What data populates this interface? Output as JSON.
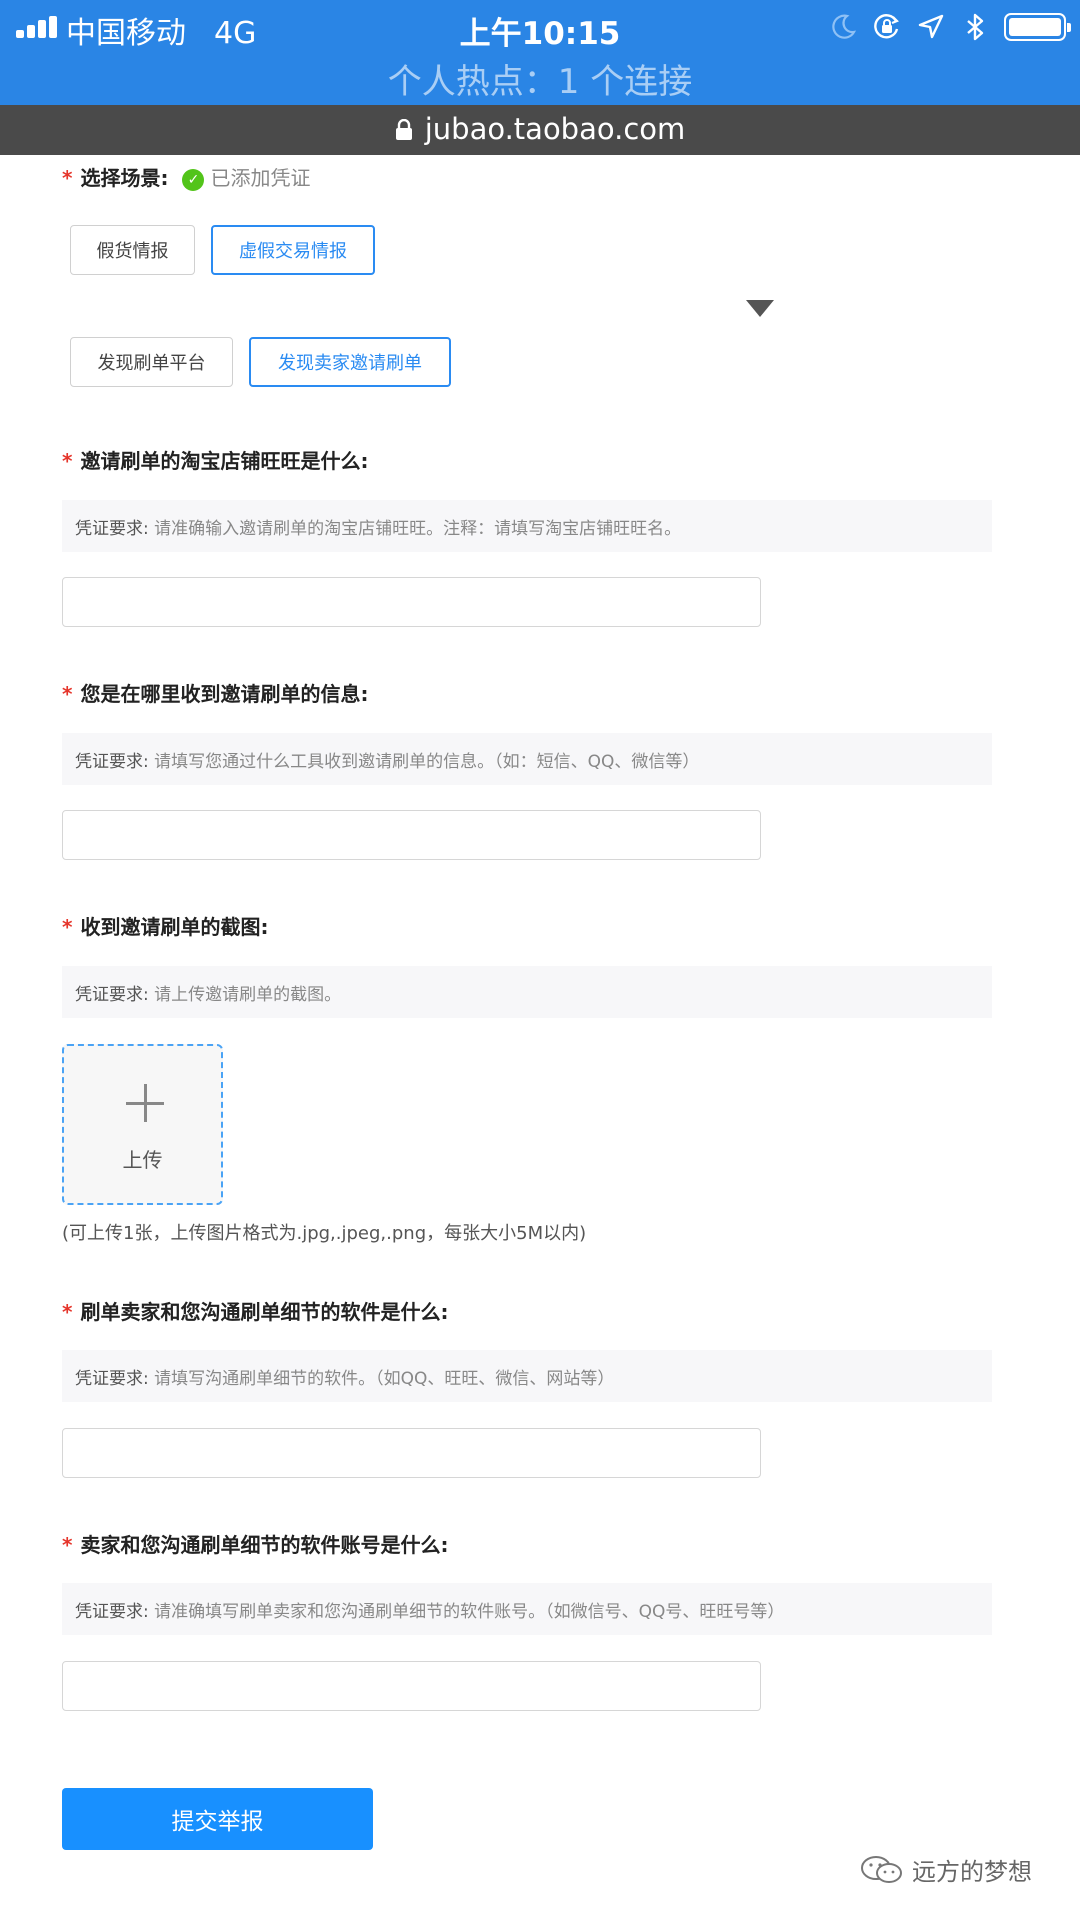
{
  "status_bar": {
    "carrier": "中国移动",
    "network": "4G",
    "time": "上午10:15",
    "hotspot": "个人热点：1 个连接"
  },
  "browser": {
    "url": "jubao.taobao.com"
  },
  "colors": {
    "primary": "#1890ff",
    "status_bar": "#2a85e5",
    "required": "#e5352b",
    "success": "#52c41a"
  },
  "icons": [
    "signal-icon",
    "moon-icon",
    "rotation-lock-icon",
    "location-icon",
    "bluetooth-icon",
    "battery-icon",
    "lock-icon",
    "check-circle-icon",
    "plus-icon",
    "wechat-icon"
  ],
  "form": {
    "required_mark": "*",
    "scene": {
      "label": "选择场景:",
      "status": "已添加凭证",
      "level1": [
        "假货情报",
        "虚假交易情报"
      ],
      "level2": [
        "发现刷单平台",
        "发现卖家邀请刷单"
      ],
      "selected_level1": "虚假交易情报",
      "selected_level2": "发现卖家邀请刷单"
    },
    "hint_prefix": "凭证要求:",
    "fields": [
      {
        "label": "邀请刷单的淘宝店铺旺旺是什么:",
        "hint": "请准确输入邀请刷单的淘宝店铺旺旺。注释：请填写淘宝店铺旺旺名。",
        "value": ""
      },
      {
        "label": "您是在哪里收到邀请刷单的信息:",
        "hint": "请填写您通过什么工具收到邀请刷单的信息。（如：短信、QQ、微信等）",
        "value": ""
      }
    ],
    "screenshot": {
      "label": "收到邀请刷单的截图:",
      "hint": "请上传邀请刷单的截图。",
      "upload_label": "上传",
      "note": "(可上传1张，上传图片格式为.jpg,.jpeg,.png，每张大小5M以内)"
    },
    "fields2": [
      {
        "label": "刷单卖家和您沟通刷单细节的软件是什么:",
        "hint": "请填写沟通刷单细节的软件。（如QQ、旺旺、微信、网站等）",
        "value": ""
      },
      {
        "label": "卖家和您沟通刷单细节的软件账号是什么:",
        "hint": "请准确填写刷单卖家和您沟通刷单细节的软件账号。（如微信号、QQ号、旺旺号等）",
        "value": ""
      }
    ],
    "submit_label": "提交举报"
  },
  "watermark": "远方的梦想"
}
